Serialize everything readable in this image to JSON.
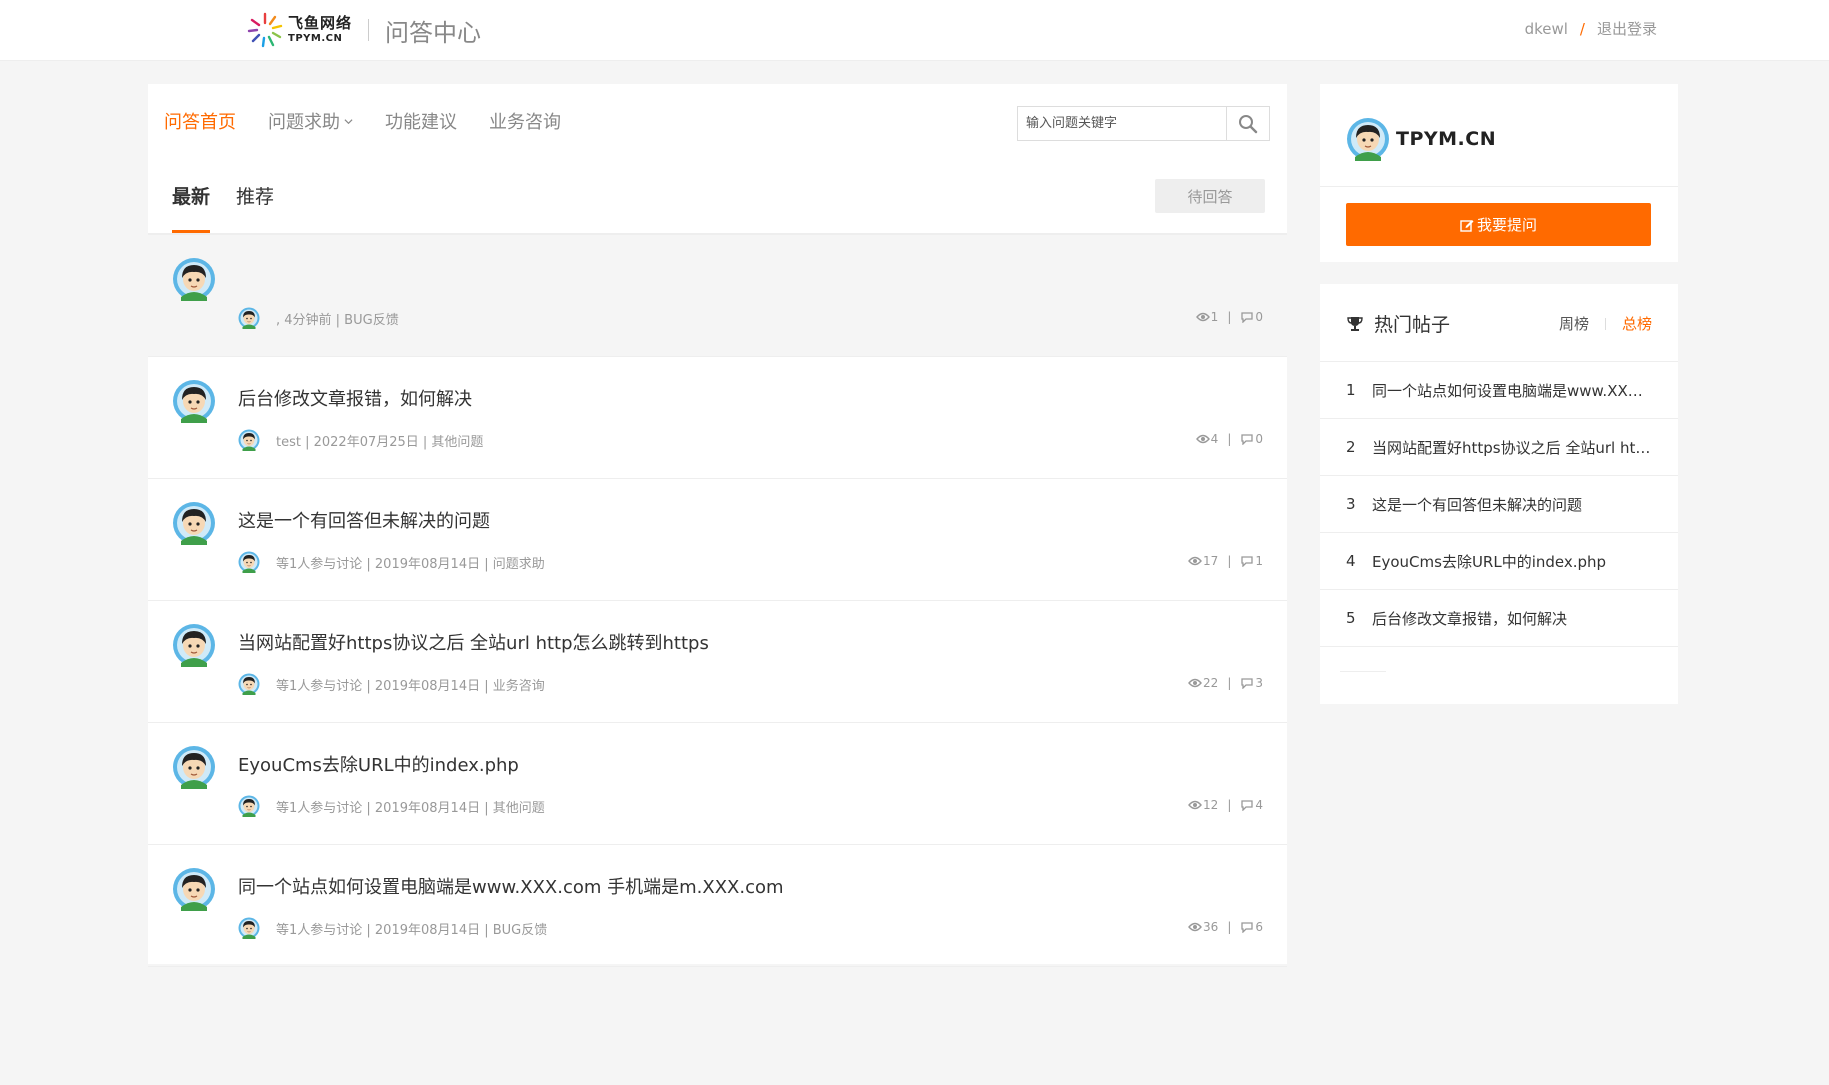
{
  "header": {
    "logo_cn": "飞鱼网络",
    "logo_en": "TPYM.CN",
    "section_title": "问答中心",
    "username": "dkewl",
    "separator": "/",
    "logout": "退出登录"
  },
  "nav": {
    "items": [
      {
        "label": "问答首页",
        "active": true
      },
      {
        "label": "问题求助",
        "has_dropdown": true
      },
      {
        "label": "功能建议"
      },
      {
        "label": "业务咨询"
      }
    ]
  },
  "search": {
    "placeholder": "输入问题关键字",
    "value": ""
  },
  "tabs": {
    "latest": "最新",
    "recommended": "推荐",
    "unanswered": "待回答"
  },
  "questions": [
    {
      "title": "",
      "meta": ", 4分钟前 | BUG反馈",
      "views": "1",
      "answers": "0"
    },
    {
      "title": "后台修改文章报错，如何解决",
      "meta": "test | 2022年07月25日 | 其他问题",
      "views": "4",
      "answers": "0"
    },
    {
      "title": "这是一个有回答但未解决的问题",
      "meta": "等1人参与讨论 | 2019年08月14日 | 问题求助",
      "views": "17",
      "answers": "1"
    },
    {
      "title": "当网站配置好https协议之后 全站url http怎么跳转到https",
      "meta": "等1人参与讨论 | 2019年08月14日 | 业务咨询",
      "views": "22",
      "answers": "3"
    },
    {
      "title": "EyouCms去除URL中的index.php",
      "meta": "等1人参与讨论 | 2019年08月14日 | 其他问题",
      "views": "12",
      "answers": "4"
    },
    {
      "title": "同一个站点如何设置电脑端是www.XXX.com 手机端是m.XXX.com",
      "meta": "等1人参与讨论 | 2019年08月14日 | BUG反馈",
      "views": "36",
      "answers": "6"
    }
  ],
  "sidebar": {
    "profile_name": "TPYM.CN",
    "ask_button": "我要提问",
    "hot_title": "热门帖子",
    "rank_weekly": "周榜",
    "rank_total": "总榜",
    "hot_items": [
      {
        "num": "1",
        "title": "同一个站点如何设置电脑端是www.XXX.com 手机端是m.XXX.com"
      },
      {
        "num": "2",
        "title": "当网站配置好https协议之后 全站url http怎么跳转到https"
      },
      {
        "num": "3",
        "title": "这是一个有回答但未解决的问题"
      },
      {
        "num": "4",
        "title": "EyouCms去除URL中的index.php"
      },
      {
        "num": "5",
        "title": "后台修改文章报错，如何解决"
      }
    ]
  },
  "colors": {
    "accent": "#ff6a00",
    "background": "#f5f5f5",
    "muted_text": "#999999"
  },
  "icons": {
    "search": "search-icon",
    "view": "eye-icon",
    "answer": "comment-icon",
    "trophy": "trophy-icon",
    "pen": "edit-icon",
    "dropdown": "chevron-down-icon"
  }
}
